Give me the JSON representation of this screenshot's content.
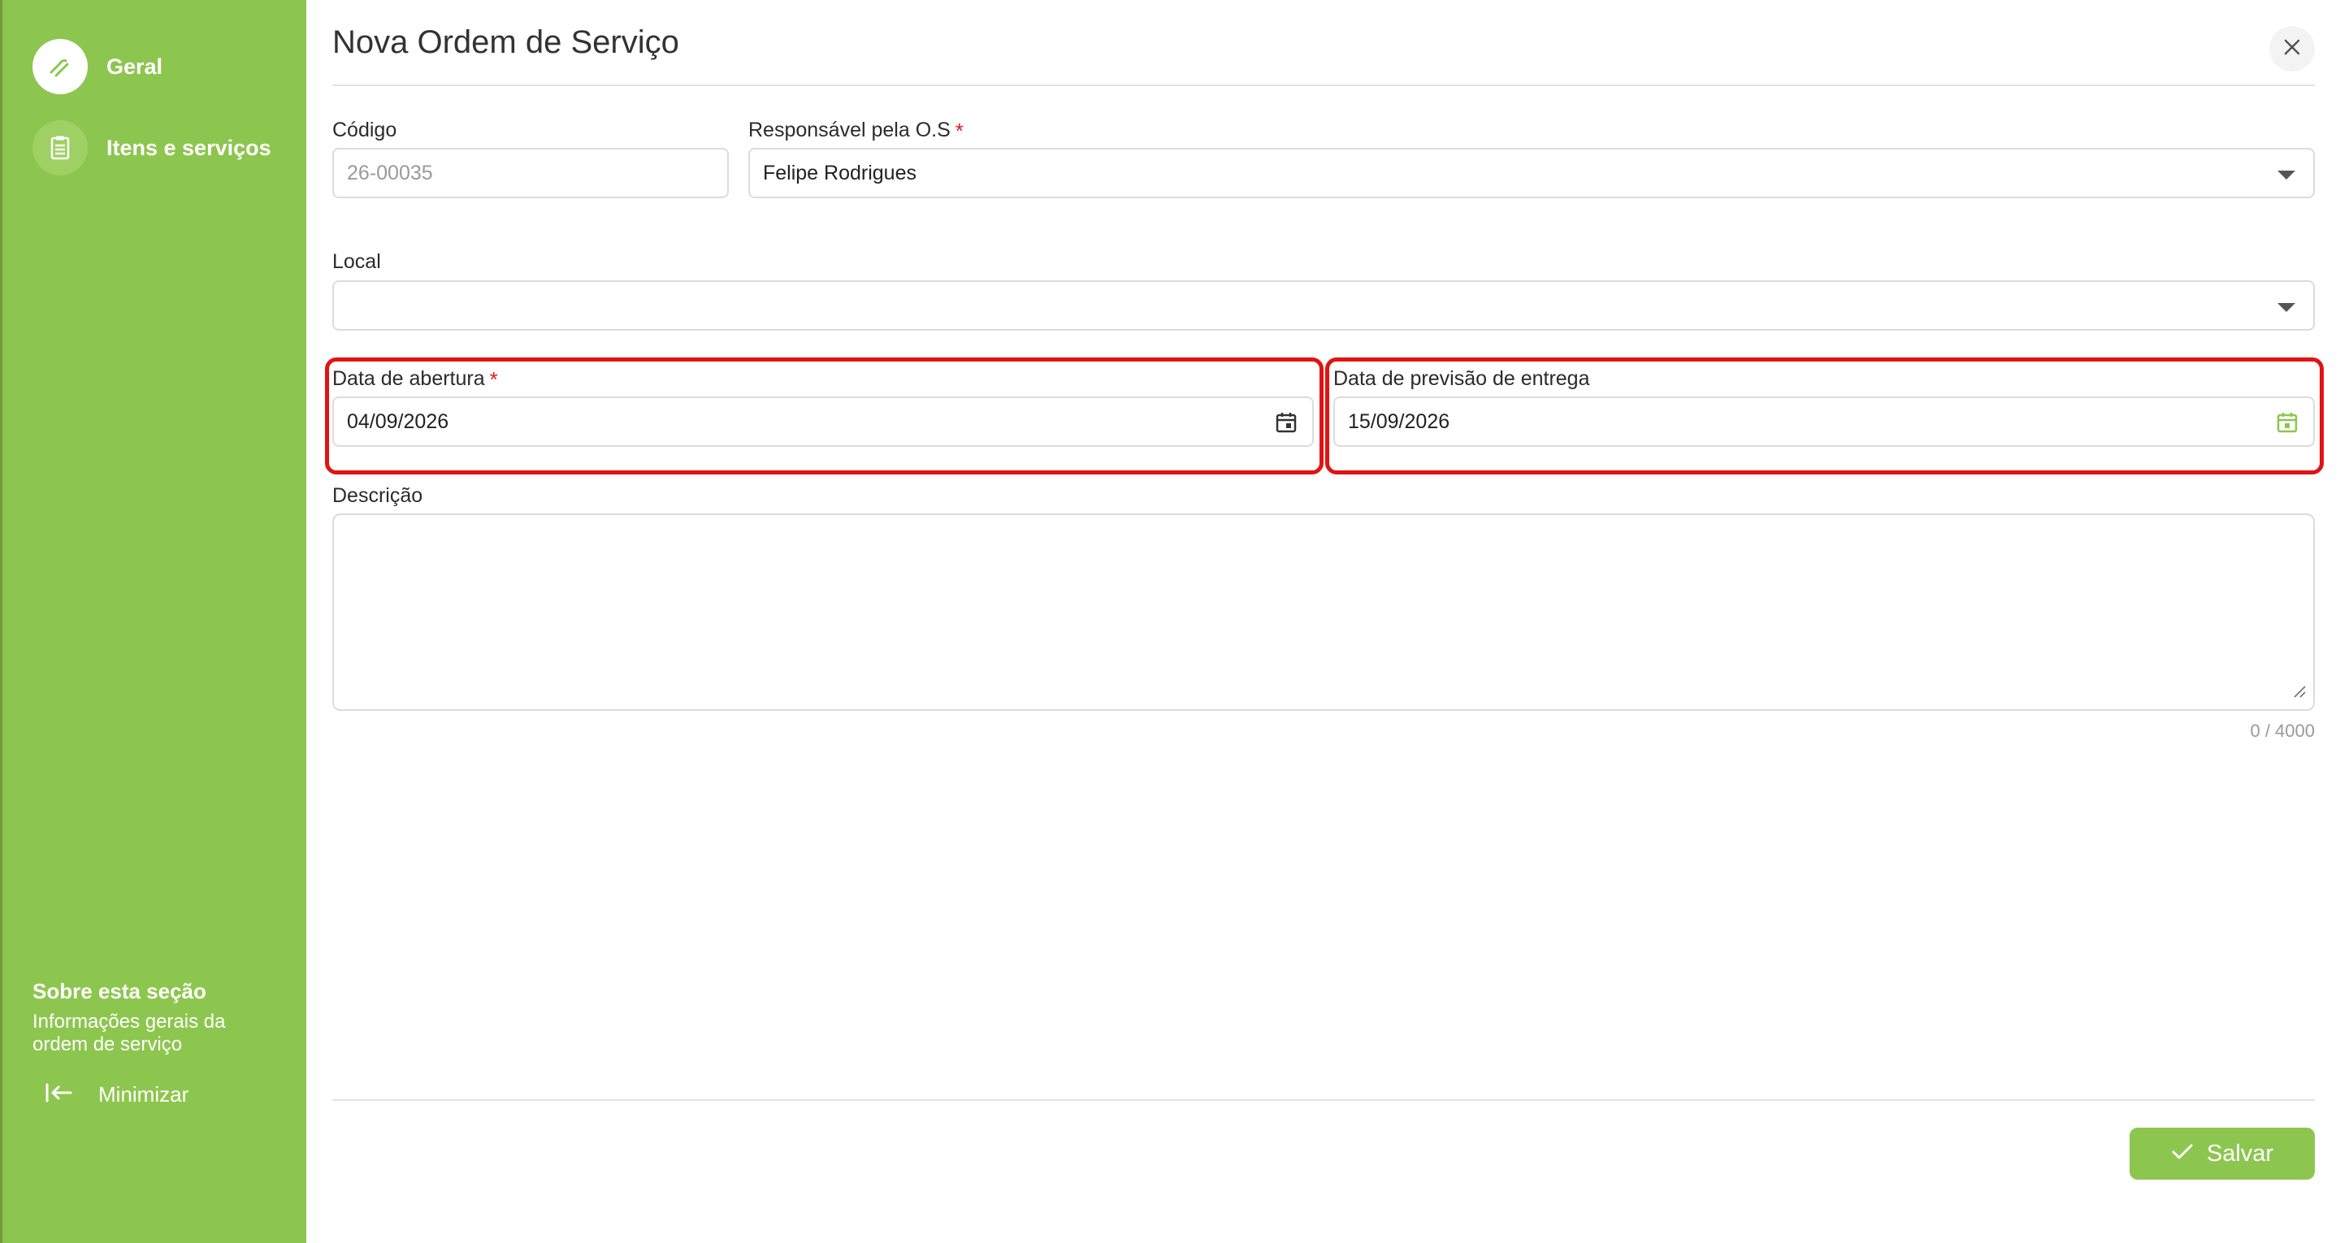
{
  "sidebar": {
    "items": [
      {
        "label": "Geral",
        "icon": "link-icon",
        "active": true
      },
      {
        "label": "Itens e serviços",
        "icon": "clipboard-icon",
        "active": false
      }
    ],
    "about": {
      "title": "Sobre esta seção",
      "text": "Informações gerais da ordem de serviço"
    },
    "minimize_label": "Minimizar"
  },
  "dialog": {
    "title": "Nova Ordem de Serviço"
  },
  "form": {
    "codigo": {
      "label": "Código",
      "value": "26-00035"
    },
    "responsavel": {
      "label": "Responsável pela O.S",
      "required": "*",
      "value": "Felipe Rodrigues"
    },
    "local": {
      "label": "Local",
      "value": ""
    },
    "data_abertura": {
      "label": "Data de abertura",
      "required": "*",
      "value": "04/09/2026"
    },
    "data_previsao": {
      "label": "Data de previsão de entrega",
      "value": "15/09/2026"
    },
    "descricao": {
      "label": "Descrição",
      "value": "",
      "counter": "0 / 4000"
    }
  },
  "footer": {
    "save_label": "Salvar"
  },
  "colors": {
    "brand_green": "#8dc64f",
    "highlight_red": "#e01414",
    "required_red": "#e21b1b"
  }
}
